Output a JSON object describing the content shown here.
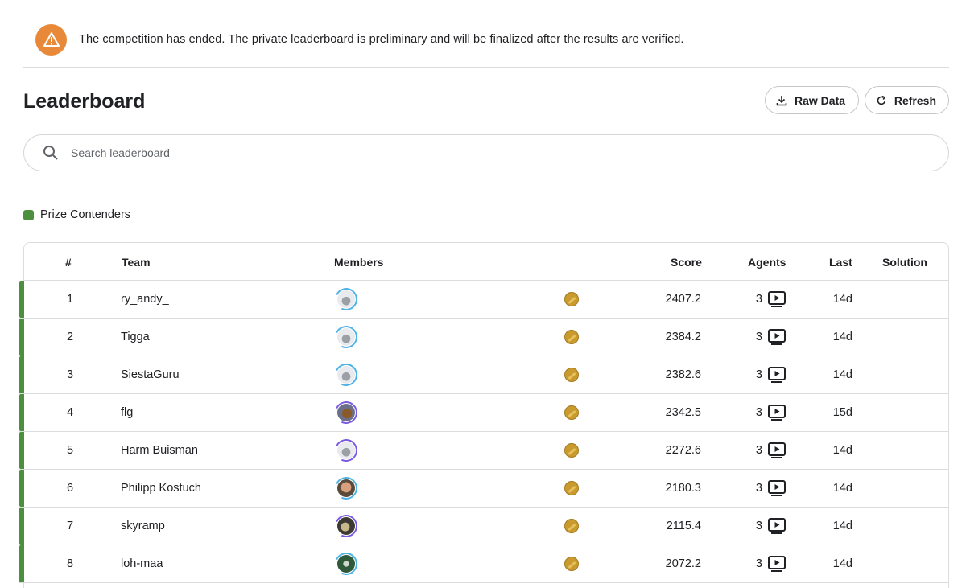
{
  "banner": {
    "icon": "warning-triangle-icon",
    "text": "The competition has ended. The private leaderboard is preliminary and will be finalized after the results are verified."
  },
  "header": {
    "title": "Leaderboard",
    "raw_data_label": "Raw Data",
    "refresh_label": "Refresh"
  },
  "search": {
    "placeholder": "Search leaderboard",
    "value": ""
  },
  "legend": {
    "label": "Prize Contenders",
    "color": "#4c8f3e"
  },
  "table": {
    "columns": {
      "rank": "#",
      "team": "Team",
      "members": "Members",
      "score": "Score",
      "agents": "Agents",
      "last": "Last",
      "solution": "Solution"
    },
    "rows": [
      {
        "rank": "1",
        "team": "ry_andy_",
        "score": "2407.2",
        "agents": "3",
        "last": "14d",
        "avatar": "gray",
        "ring": "blue"
      },
      {
        "rank": "2",
        "team": "Tigga",
        "score": "2384.2",
        "agents": "3",
        "last": "14d",
        "avatar": "gray",
        "ring": "blue"
      },
      {
        "rank": "3",
        "team": "SiestaGuru",
        "score": "2382.6",
        "agents": "3",
        "last": "14d",
        "avatar": "gray",
        "ring": "blue"
      },
      {
        "rank": "4",
        "team": "flg",
        "score": "2342.5",
        "agents": "3",
        "last": "15d",
        "avatar": "brown",
        "ring": "purple"
      },
      {
        "rank": "5",
        "team": "Harm Buisman",
        "score": "2272.6",
        "agents": "3",
        "last": "14d",
        "avatar": "gray",
        "ring": "purple"
      },
      {
        "rank": "6",
        "team": "Philipp Kostuch",
        "score": "2180.3",
        "agents": "3",
        "last": "14d",
        "avatar": "face",
        "ring": "blue"
      },
      {
        "rank": "7",
        "team": "skyramp",
        "score": "2115.4",
        "agents": "3",
        "last": "14d",
        "avatar": "dark",
        "ring": "purple"
      },
      {
        "rank": "8",
        "team": "loh-maa",
        "score": "2072.2",
        "agents": "3",
        "last": "14d",
        "avatar": "green",
        "ring": "blue"
      }
    ]
  },
  "colors": {
    "accent_orange": "#e8893a",
    "prize_green": "#4c8f3e",
    "medal_gold": "#c99a2e",
    "ring_blue": "#4fb3e6",
    "ring_purple": "#7a5ae0"
  }
}
